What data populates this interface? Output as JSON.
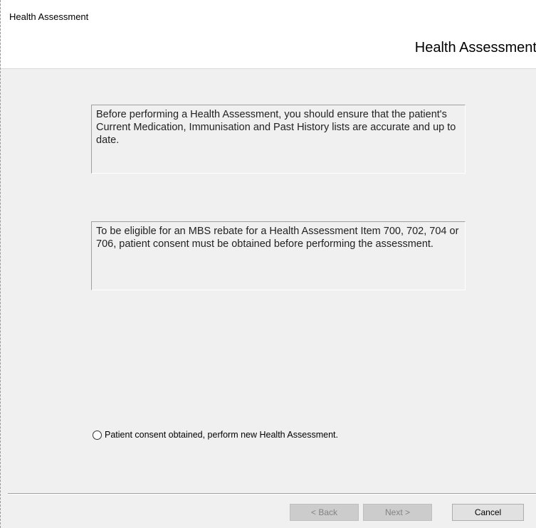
{
  "window": {
    "title": "Health Assessment"
  },
  "header": {
    "title": "Health Assessment"
  },
  "info": {
    "box1_text": "Before performing a Health Assessment, you should ensure that the patient's Current Medication, Immunisation and Past History lists are accurate and up to date.",
    "box2_text": "To be eligible for an MBS rebate for a Health Assessment Item 700, 702, 704 or 706, patient consent must be obtained before performing the assessment."
  },
  "consent": {
    "label": "Patient consent obtained, perform new Health Assessment.",
    "selected": false
  },
  "buttons": {
    "back_label": "< Back",
    "next_label": "Next >",
    "cancel_label": "Cancel"
  }
}
